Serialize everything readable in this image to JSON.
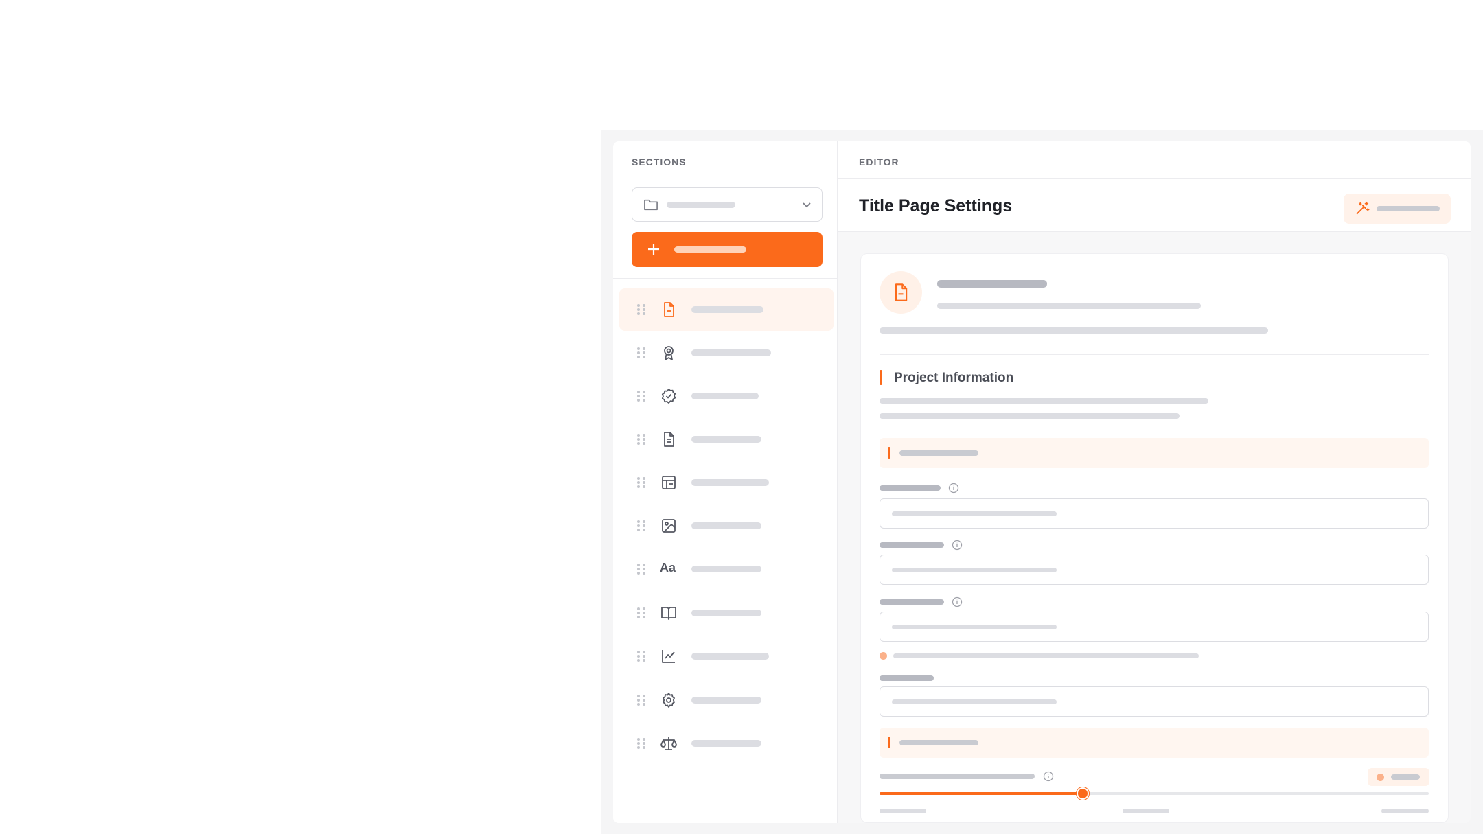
{
  "sidebar": {
    "label": "SECTIONS",
    "items": [
      {
        "icon": "file-orange-icon",
        "active": true
      },
      {
        "icon": "award-icon"
      },
      {
        "icon": "badge-check-icon"
      },
      {
        "icon": "file-text-icon"
      },
      {
        "icon": "table-layout-icon"
      },
      {
        "icon": "image-icon"
      },
      {
        "icon": "typography-icon",
        "glyph": "Aa"
      },
      {
        "icon": "book-open-icon"
      },
      {
        "icon": "line-chart-icon"
      },
      {
        "icon": "gear-icon"
      },
      {
        "icon": "scale-icon"
      }
    ]
  },
  "editor": {
    "label": "EDITOR",
    "title": "Title Page Settings",
    "section_heading": "Project Information"
  },
  "colors": {
    "accent": "#fb6a1b",
    "accent_light": "#fff4ee",
    "placeholder_bar": "#dcdde2"
  },
  "slider": {
    "value_fraction": 0.37
  }
}
